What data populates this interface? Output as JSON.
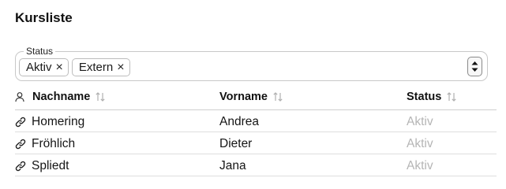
{
  "page": {
    "title": "Kursliste"
  },
  "filter": {
    "legend": "Status",
    "chips": [
      {
        "label": "Aktiv",
        "remove_glyph": "×"
      },
      {
        "label": "Extern",
        "remove_glyph": "×"
      }
    ],
    "stepper_icon": "up-down-chevrons"
  },
  "table": {
    "columns": [
      {
        "label": "Nachname",
        "icon": "user-icon",
        "sort_icon": "sort-arrows-icon"
      },
      {
        "label": "Vorname",
        "sort_icon": "sort-arrows-icon"
      },
      {
        "label": "Status",
        "sort_icon": "sort-arrows-icon"
      }
    ],
    "rows": [
      {
        "nachname": "Homering",
        "vorname": "Andrea",
        "status": "Aktiv"
      },
      {
        "nachname": "Fröhlich",
        "vorname": "Dieter",
        "status": "Aktiv"
      },
      {
        "nachname": "Spliedt",
        "vorname": "Jana",
        "status": "Aktiv"
      }
    ],
    "row_icon": "link-icon"
  },
  "colors": {
    "muted_status": "#b5b5b5",
    "border": "#c8c8c8"
  }
}
